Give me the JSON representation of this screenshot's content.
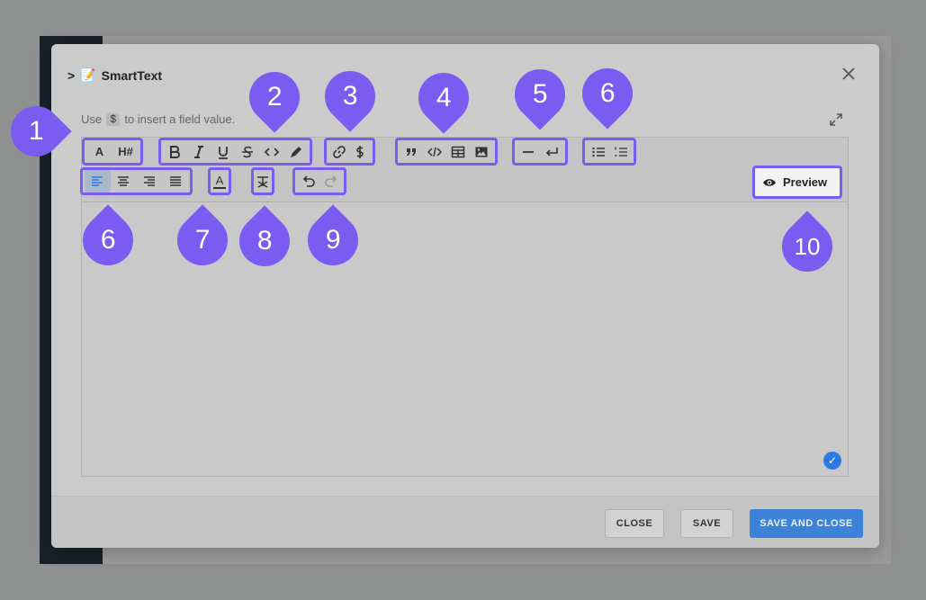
{
  "modal": {
    "chevron": ">",
    "emoji": "📝",
    "title": "SmartText",
    "close_icon": "close-icon"
  },
  "hint": {
    "prefix": "Use",
    "code": "$",
    "suffix": "to insert a field value."
  },
  "toolbar": {
    "heading_size": "A",
    "heading_num": "H#",
    "preview_label": "Preview",
    "text_color_letter": "A"
  },
  "footer": {
    "close_label": "CLOSE",
    "save_label": "SAVE",
    "save_close_label": "SAVE AND CLOSE"
  },
  "callouts": [
    "1",
    "2",
    "3",
    "4",
    "5",
    "6",
    "6",
    "7",
    "8",
    "9",
    "10"
  ],
  "colors": {
    "accent": "#7a5cf0",
    "primary": "#3c82d8",
    "check": "#2c7be5"
  }
}
